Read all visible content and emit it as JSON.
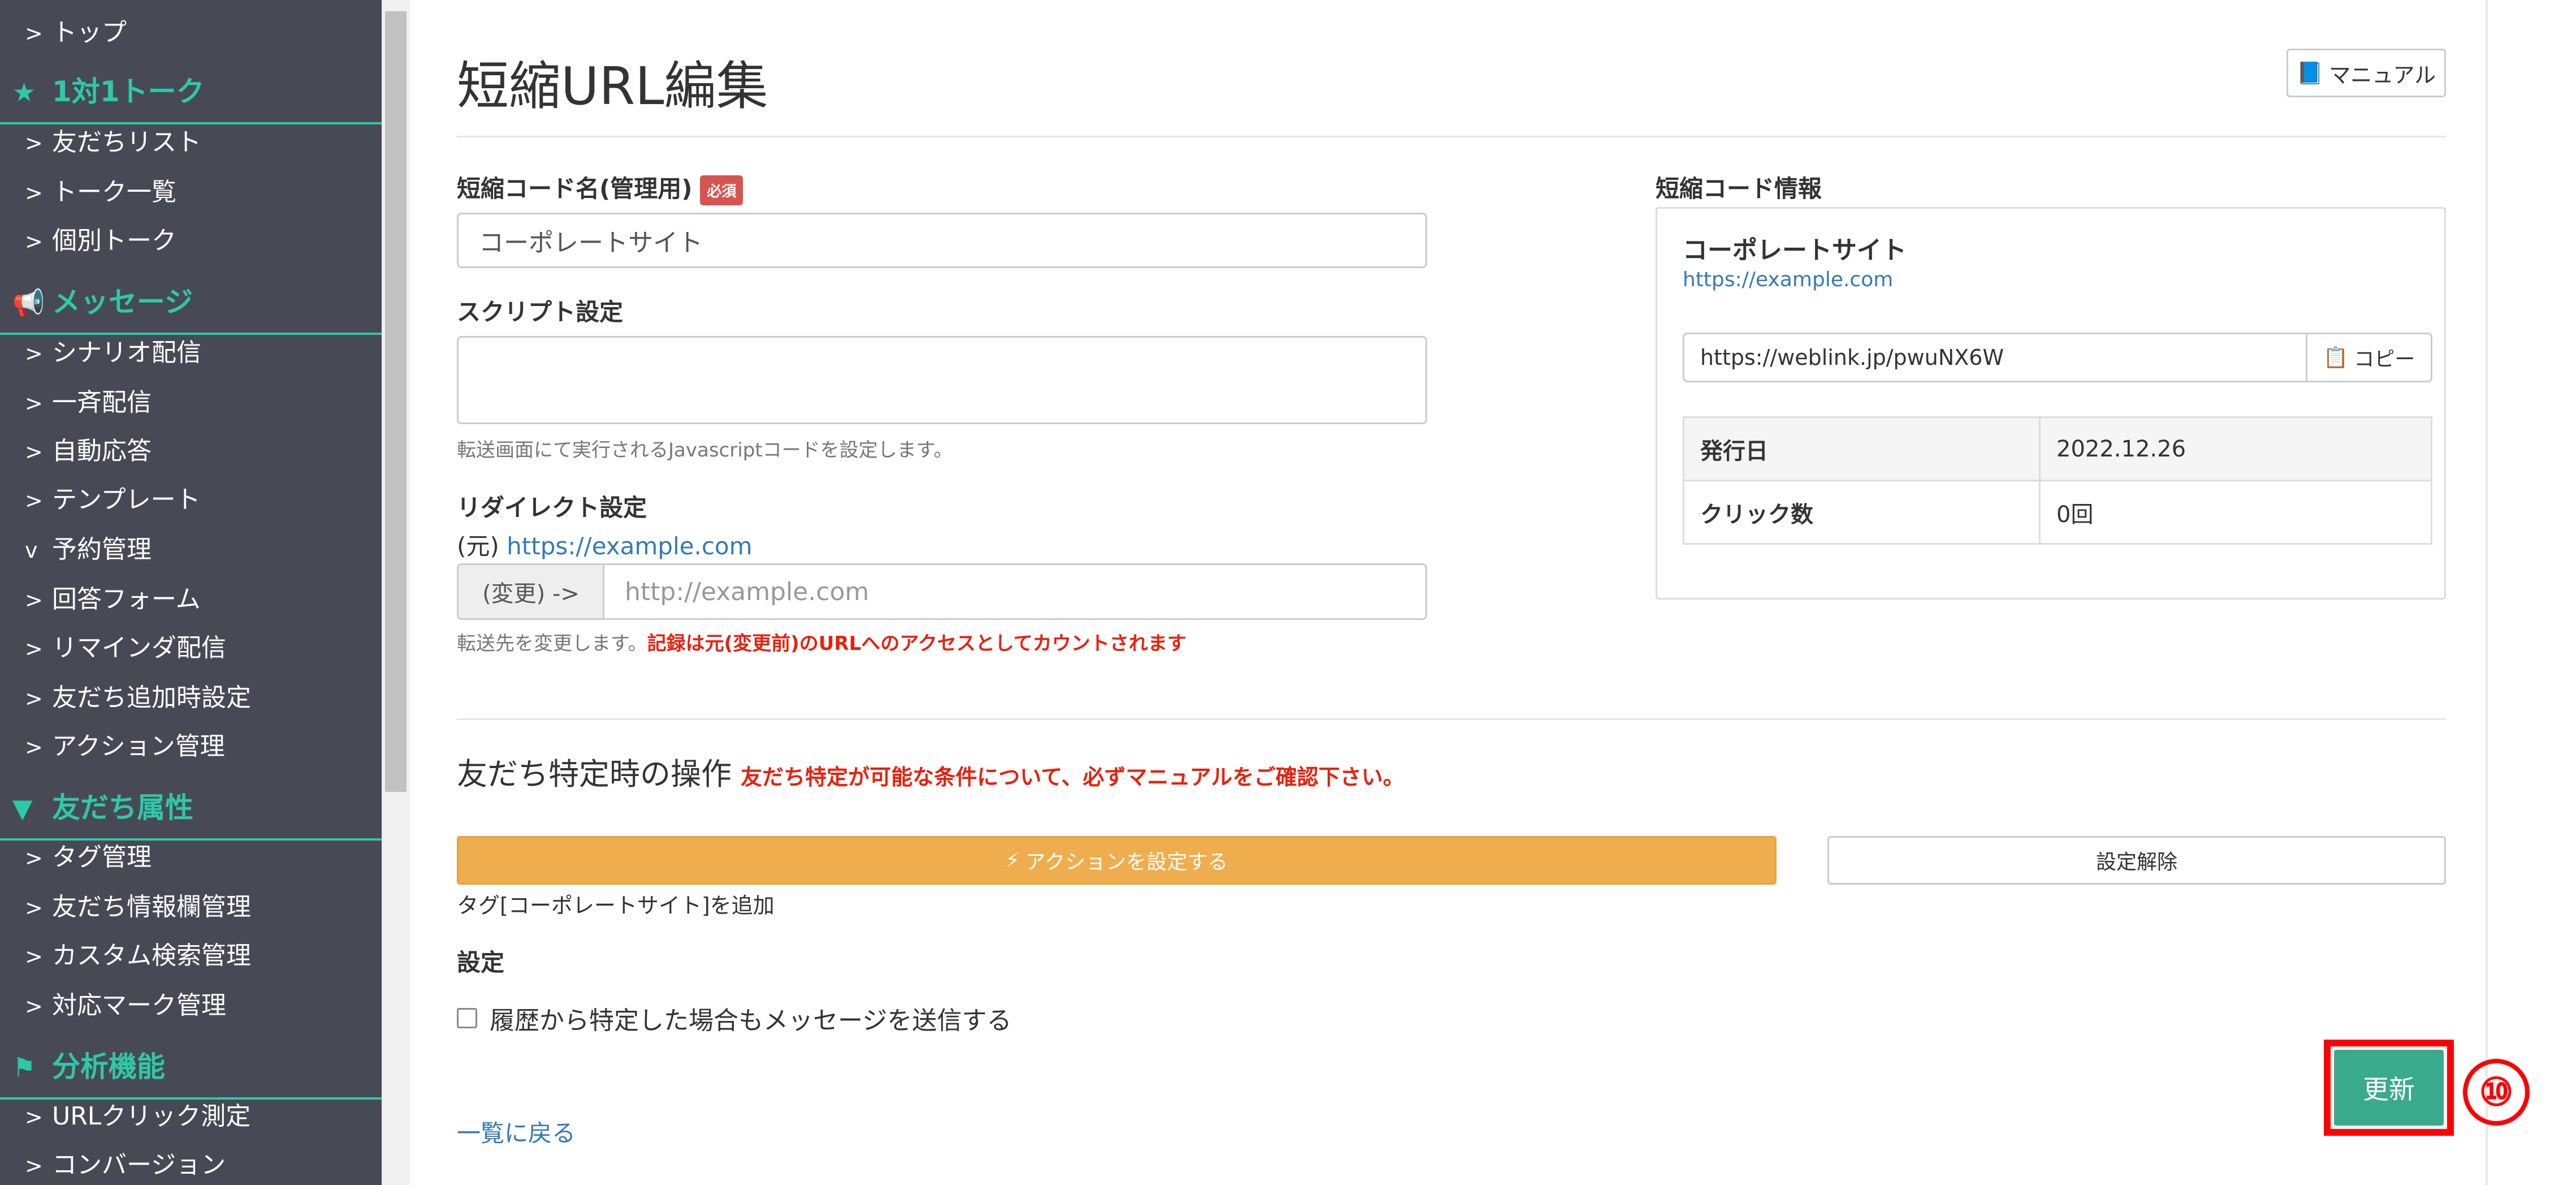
{
  "sidebar": {
    "items": [
      {
        "type": "item",
        "label": "トップ"
      },
      {
        "type": "section",
        "label": "1対1トーク",
        "icon": "star-icon"
      },
      {
        "type": "item",
        "label": "友だちリスト"
      },
      {
        "type": "item",
        "label": "トーク一覧"
      },
      {
        "type": "item",
        "label": "個別トーク"
      },
      {
        "type": "section",
        "label": "メッセージ",
        "icon": "megaphone-icon"
      },
      {
        "type": "item",
        "label": "シナリオ配信"
      },
      {
        "type": "item",
        "label": "一斉配信"
      },
      {
        "type": "item",
        "label": "自動応答"
      },
      {
        "type": "item",
        "label": "テンプレート"
      },
      {
        "type": "item",
        "label": "予約管理",
        "expanded": true
      },
      {
        "type": "item",
        "label": "回答フォーム"
      },
      {
        "type": "item",
        "label": "リマインダ配信"
      },
      {
        "type": "item",
        "label": "友だち追加時設定"
      },
      {
        "type": "item",
        "label": "アクション管理"
      },
      {
        "type": "section",
        "label": "友だち属性",
        "icon": "filter-icon"
      },
      {
        "type": "item",
        "label": "タグ管理"
      },
      {
        "type": "item",
        "label": "友だち情報欄管理"
      },
      {
        "type": "item",
        "label": "カスタム検索管理"
      },
      {
        "type": "item",
        "label": "対応マーク管理"
      },
      {
        "type": "section",
        "label": "分析機能",
        "icon": "flag-icon"
      },
      {
        "type": "item",
        "label": "URLクリック測定"
      },
      {
        "type": "item",
        "label": "コンバージョン"
      }
    ]
  },
  "header": {
    "title": "短縮URL編集",
    "manual_label": "マニュアル"
  },
  "form": {
    "name_label": "短縮コード名(管理用)",
    "required_badge": "必須",
    "name_value": "コーポレートサイト",
    "script_label": "スクリプト設定",
    "script_value": "",
    "script_help": "転送画面にて実行されるJavascriptコードを設定します。",
    "redirect_label": "リダイレクト設定",
    "original_prefix": "(元)",
    "original_url": "https://example.com",
    "change_addon": "(変更) ->",
    "change_placeholder": "http://example.com",
    "redirect_help": "転送先を変更します。",
    "redirect_help_red": "記録は元(変更前)のURLへのアクセスとしてカウントされます"
  },
  "info": {
    "title": "短縮コード情報",
    "name": "コーポレートサイト",
    "url": "https://example.com",
    "short_url": "https://weblink.jp/pwuNX6W",
    "copy_label": "コピー",
    "rows": [
      {
        "label": "発行日",
        "value": "2022.12.26"
      },
      {
        "label": "クリック数",
        "value": "0回"
      }
    ]
  },
  "friend_action": {
    "title": "友だち特定時の操作",
    "warning": "友だち特定が可能な条件について、必ずマニュアルをご確認下さい。",
    "set_action_label": "アクションを設定する",
    "clear_label": "設定解除",
    "tag_text": "タグ[コーポレートサイト]を追加",
    "settings_label": "設定",
    "checkbox_label": "履歴から特定した場合もメッセージを送信する",
    "checkbox_checked": false
  },
  "footer": {
    "update_label": "更新",
    "step_number": "⑩",
    "back_label": "一覧に戻る"
  },
  "colors": {
    "sidebar_bg": "#474a55",
    "sidebar_accent": "#2ec9a7",
    "action_button": "#f0ad4e",
    "update_button": "#3aaa8d",
    "highlight_red": "#ff0000",
    "link": "#337ab7"
  }
}
